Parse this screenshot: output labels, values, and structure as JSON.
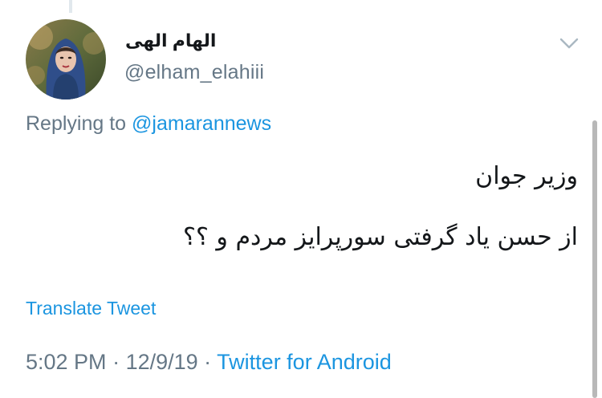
{
  "tweet": {
    "display_name": "الهام الهی",
    "username": "@elham_elahiii",
    "replying_prefix": "Replying to ",
    "replying_to": "@jamarannews",
    "text_line1": "وزیر جوان",
    "text_line2": "از حسن یاد گرفتی سورپرایز مردم و ؟؟",
    "translate_label": "Translate Tweet",
    "time": "5:02 PM",
    "separator1": " · ",
    "date": "12/9/19",
    "separator2": " · ",
    "source": "Twitter for Android"
  },
  "icons": {
    "avatar": "profile-photo",
    "menu": "chevron-down-icon"
  },
  "colors": {
    "link": "#1b95e0",
    "secondary_text": "#657786",
    "primary_text": "#14171a"
  }
}
